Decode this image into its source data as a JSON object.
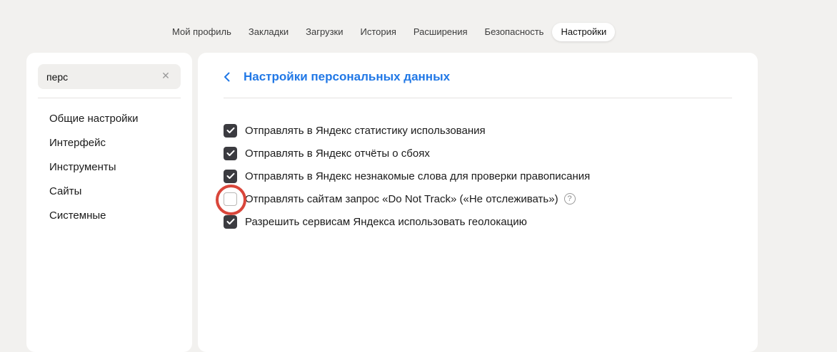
{
  "topnav": {
    "items": [
      {
        "label": "Мой профиль",
        "active": false
      },
      {
        "label": "Закладки",
        "active": false
      },
      {
        "label": "Загрузки",
        "active": false
      },
      {
        "label": "История",
        "active": false
      },
      {
        "label": "Расширения",
        "active": false
      },
      {
        "label": "Безопасность",
        "active": false
      },
      {
        "label": "Настройки",
        "active": true
      }
    ]
  },
  "sidebar": {
    "search": {
      "value": "перс",
      "clear_icon": "close-icon"
    },
    "items": [
      {
        "label": "Общие настройки"
      },
      {
        "label": "Интерфейс"
      },
      {
        "label": "Инструменты"
      },
      {
        "label": "Сайты"
      },
      {
        "label": "Системные"
      }
    ]
  },
  "main": {
    "back_icon": "chevron-left-icon",
    "title": "Настройки персональных данных",
    "title_color": "#2178e6",
    "options": [
      {
        "label": "Отправлять в Яндекс статистику использования",
        "checked": true
      },
      {
        "label": "Отправлять в Яндекс отчёты о сбоях",
        "checked": true
      },
      {
        "label": "Отправлять в Яндекс незнакомые слова для проверки правописания",
        "checked": true
      },
      {
        "label": "Отправлять сайтам запрос «Do Not Track» («Не отслеживать»)",
        "checked": false,
        "help_icon": "?",
        "highlighted": true
      },
      {
        "label": "Разрешить сервисам Яндекса использовать геолокацию",
        "checked": true
      }
    ],
    "highlight_color": "#d9463b"
  }
}
